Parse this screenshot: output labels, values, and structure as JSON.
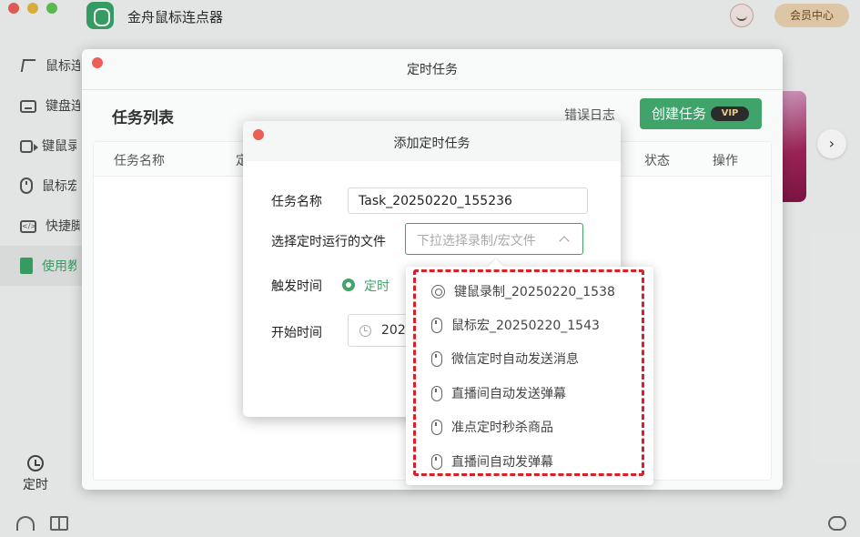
{
  "app": {
    "title": "金舟鼠标连点器",
    "member_label": "会员中心"
  },
  "sidebar": {
    "items": [
      {
        "label": "鼠标连点",
        "icon": "cursor-click-icon"
      },
      {
        "label": "键盘连按",
        "icon": "keyboard-icon"
      },
      {
        "label": "键鼠录制",
        "icon": "video-record-icon"
      },
      {
        "label": "鼠标宏",
        "icon": "mouse-icon"
      },
      {
        "label": "快捷脚本",
        "icon": "code-icon"
      },
      {
        "label": "使用教程",
        "icon": "book-icon"
      }
    ],
    "timer_label": "定时"
  },
  "task_window": {
    "title": "定时任务",
    "list_title": "任务列表",
    "error_log": "错误日志",
    "create_button": "创建任务",
    "vip_badge": "VIP",
    "columns": [
      "任务名称",
      "定",
      "状态",
      "操作"
    ]
  },
  "add_dialog": {
    "title": "添加定时任务",
    "task_name_label": "任务名称",
    "task_name_value": "Task_20250220_155236",
    "file_label": "选择定时运行的文件",
    "file_placeholder": "下拉选择录制/宏文件",
    "trigger_label": "触发时间",
    "trigger_option": "定时",
    "start_label": "开始时间",
    "start_value": "202"
  },
  "dropdown": {
    "options": [
      {
        "label": "键鼠录制_20250220_1538",
        "icon": "record-icon"
      },
      {
        "label": "鼠标宏_20250220_1543",
        "icon": "mouse-icon"
      },
      {
        "label": "微信定时自动发送消息",
        "icon": "mouse-icon"
      },
      {
        "label": "直播间自动发送弹幕",
        "icon": "mouse-icon"
      },
      {
        "label": "准点定时秒杀商品",
        "icon": "mouse-icon"
      },
      {
        "label": "直播间自动发弹幕",
        "icon": "mouse-icon"
      }
    ]
  },
  "colors": {
    "accent": "#3fa36a",
    "highlight": "#d8202a"
  }
}
